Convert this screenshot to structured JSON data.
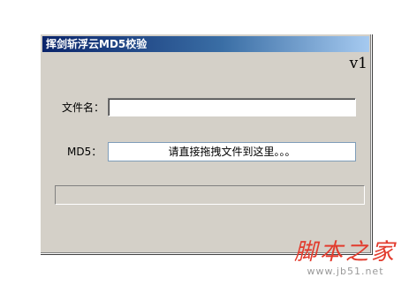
{
  "window": {
    "title": "挥剑斩浮云MD5校验",
    "version": "v1"
  },
  "form": {
    "filename_label": "文件名：",
    "filename_value": "",
    "md5_label": "MD5：",
    "md5_placeholder_text": "请直接拖拽文件到这里。。。"
  },
  "progress": {
    "value": 0
  },
  "watermark": {
    "name": "脚本之家",
    "url": "www.jb51.net"
  },
  "colors": {
    "window_bg": "#d4d0c8",
    "titlebar_start": "#0a246a",
    "titlebar_end": "#a6caf0",
    "watermark_red": "#e23b2d"
  }
}
